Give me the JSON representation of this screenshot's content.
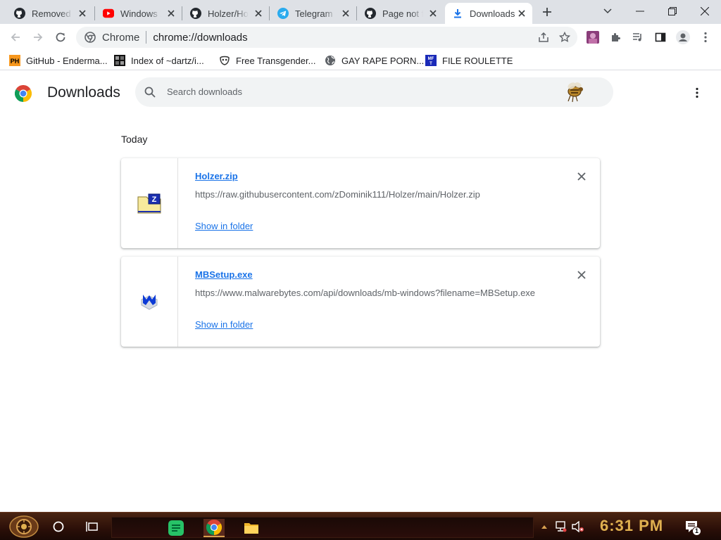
{
  "tabs": [
    {
      "title": "Removed F",
      "icon": "github-icon"
    },
    {
      "title": "Windows X",
      "icon": "youtube-icon"
    },
    {
      "title": "Holzer/Ho",
      "icon": "github-icon"
    },
    {
      "title": "Telegram",
      "icon": "telegram-icon"
    },
    {
      "title": "Page not fo",
      "icon": "github-icon"
    },
    {
      "title": "Downloads",
      "icon": "download-icon",
      "active": true
    }
  ],
  "omnibox": {
    "chip_label": "Chrome",
    "url": "chrome://downloads"
  },
  "bookmarks": [
    {
      "label": "GitHub - Enderma...",
      "icon": "ph-icon"
    },
    {
      "label": "Index of ~dartz/i...",
      "icon": "folder-grid-icon"
    },
    {
      "label": "Free Transgender...",
      "icon": "mask-icon"
    },
    {
      "label": "GAY RAPE PORN...",
      "icon": "globe-icon"
    },
    {
      "label": "FILE ROULETTE",
      "icon": "mft-icon"
    }
  ],
  "downloads_page": {
    "title": "Downloads",
    "search_placeholder": "Search downloads",
    "section_label": "Today",
    "items": [
      {
        "file": "Holzer.zip",
        "url": "https://raw.githubusercontent.com/zDominik111/Holzer/main/Holzer.zip",
        "action": "Show in folder",
        "icon": "zip-file-icon"
      },
      {
        "file": "MBSetup.exe",
        "url": "https://www.malwarebytes.com/api/downloads/mb-windows?filename=MBSetup.exe",
        "action": "Show in folder",
        "icon": "malwarebytes-icon"
      }
    ]
  },
  "taskbar": {
    "time": "6:31 PM",
    "notification_count": "1"
  },
  "colors": {
    "accent": "#1a73e8",
    "tab_strip": "#dee1e6",
    "taskbar": "#2b0f08",
    "clock": "#e0b050"
  }
}
